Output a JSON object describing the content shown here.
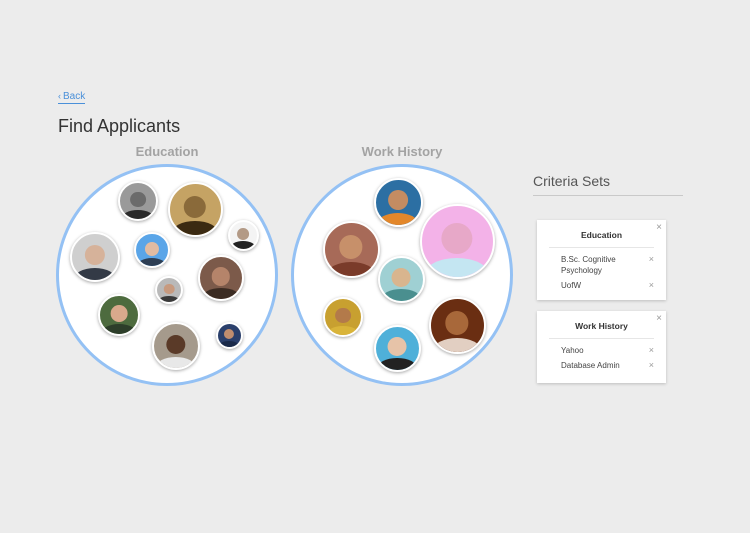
{
  "nav": {
    "back_label": "Back",
    "back_icon": "chevron-left-icon"
  },
  "page": {
    "title": "Find Applicants"
  },
  "groups": [
    {
      "title": "Education",
      "applicants": [
        {
          "tone": "#6b6b6b",
          "bg": "#9a9a9a",
          "shirt": "#2a2a2a"
        },
        {
          "tone": "#8a6a3a",
          "bg": "#c5a364",
          "shirt": "#3b2a12"
        },
        {
          "tone": "#b39a86",
          "bg": "#f4f4f4",
          "shirt": "#222222"
        },
        {
          "tone": "#d6b29a",
          "bg": "#cfcfcf",
          "shirt": "#333a46"
        },
        {
          "tone": "#e1bba2",
          "bg": "#5aa5e8",
          "shirt": "#2d3e54"
        },
        {
          "tone": "#c79a7f",
          "bg": "#b9b9b9",
          "shirt": "#3a3a3a"
        },
        {
          "tone": "#b5846a",
          "bg": "#7c5a4a",
          "shirt": "#3b2b22"
        },
        {
          "tone": "#d9a98c",
          "bg": "#4d6b3e",
          "shirt": "#2d3e2a"
        },
        {
          "tone": "#5a3a28",
          "bg": "#a59a8c",
          "shirt": "#e8e8e8"
        },
        {
          "tone": "#c08d6e",
          "bg": "#2a3f6b",
          "shirt": "#1a2a4a"
        }
      ]
    },
    {
      "title": "Work History",
      "applicants": [
        {
          "tone": "#c48c62",
          "bg": "#2c6fa3",
          "shirt": "#e3872a"
        },
        {
          "tone": "#e7a8c8",
          "bg": "#f3b2e8",
          "shirt": "#c4e6f2"
        },
        {
          "tone": "#c7906a",
          "bg": "#a76a58",
          "shirt": "#7a3b2a"
        },
        {
          "tone": "#d9b58e",
          "bg": "#9fd0d3",
          "shirt": "#4a8f8f"
        },
        {
          "tone": "#b37a4a",
          "bg": "#c8a030",
          "shirt": "#d9b43a"
        },
        {
          "tone": "#a8683a",
          "bg": "#6a2e12",
          "shirt": "#e2cfc2"
        },
        {
          "tone": "#e6c3a8",
          "bg": "#4fb0d9",
          "shirt": "#222222"
        }
      ]
    }
  ],
  "criteria": {
    "title": "Criteria Sets",
    "sets": [
      {
        "title": "Education",
        "items": [
          "B.Sc. Cognitive Psychology",
          "UofW"
        ]
      },
      {
        "title": "Work History",
        "items": [
          "Yahoo",
          "Database Admin"
        ]
      }
    ]
  },
  "icons": {
    "close": "×",
    "remove": "×"
  },
  "colors": {
    "accent": "#4a90d9",
    "bubble_border": "#94c1f4",
    "background": "#ececec"
  }
}
